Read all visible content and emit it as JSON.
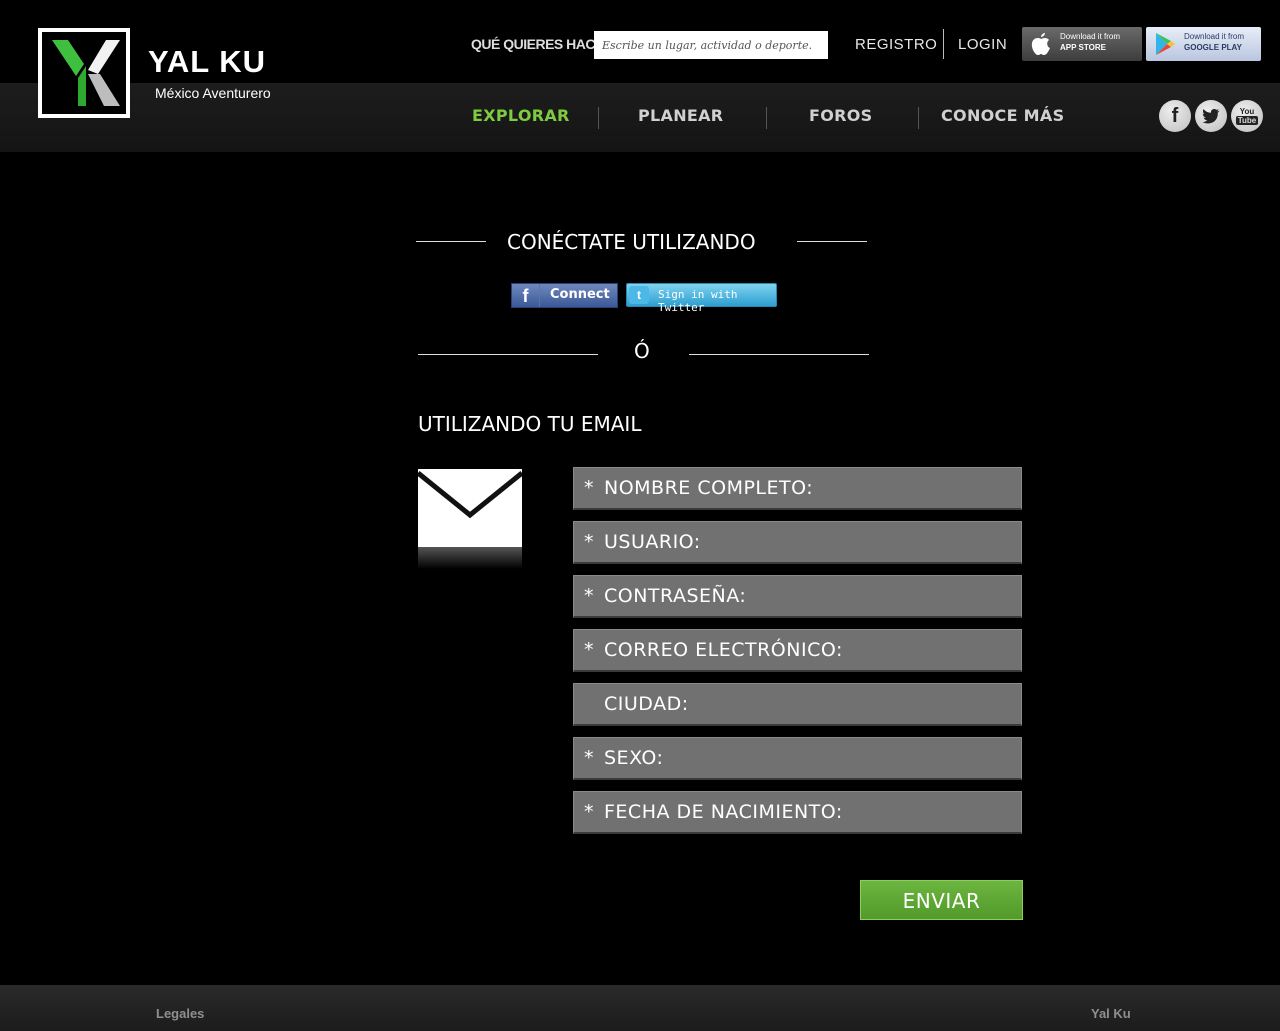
{
  "brand": {
    "name": "YAL KU",
    "tagline": "México Aventurero"
  },
  "search": {
    "label": "QUÉ QUIERES HACER?",
    "placeholder": "Escribe un lugar, actividad o deporte."
  },
  "account": {
    "register": "REGISTRO",
    "login": "LOGIN"
  },
  "stores": {
    "appstore_small": "Download it from",
    "appstore_big": "APP STORE",
    "googleplay_small": "Download it from",
    "googleplay_big": "GOOGLE PLAY"
  },
  "nav": {
    "items": [
      {
        "label": "EXPLORAR",
        "active": true
      },
      {
        "label": "PLANEAR",
        "active": false
      },
      {
        "label": "FOROS",
        "active": false
      },
      {
        "label": "CONOCE MÁS",
        "active": false
      }
    ],
    "accent_color": "#7fcb3f"
  },
  "social": {
    "facebook": "f",
    "youtube_top": "You",
    "youtube_bottom": "Tube"
  },
  "connect": {
    "heading": "CONÉCTATE UTILIZANDO",
    "facebook_button": "Connect",
    "facebook_glyph": "f",
    "twitter_button": "Sign in with Twitter",
    "twitter_glyph": "t",
    "or_text": "Ó"
  },
  "email_form": {
    "heading": "UTILIZANDO TU EMAIL",
    "required_mark": "*",
    "fields": [
      {
        "label": "NOMBRE COMPLETO:",
        "required": true
      },
      {
        "label": "USUARIO:",
        "required": true
      },
      {
        "label": "CONTRASEÑA:",
        "required": true
      },
      {
        "label": "CORREO ELECTRÓNICO:",
        "required": true
      },
      {
        "label": "CIUDAD:",
        "required": false
      },
      {
        "label": "SEXO:",
        "required": true
      },
      {
        "label": "FECHA DE NACIMIENTO:",
        "required": true
      }
    ],
    "submit": "ENVIAR",
    "submit_color": "#5fa836"
  },
  "footer": {
    "legal": "Legales",
    "brand": "Yal Ku"
  }
}
